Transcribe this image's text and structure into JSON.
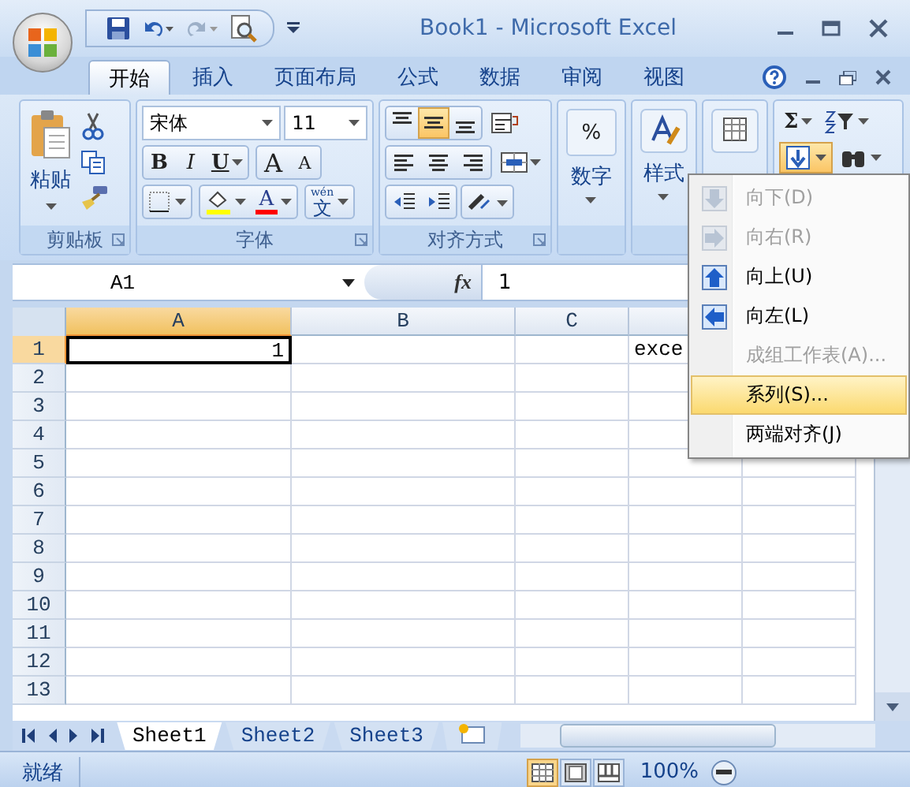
{
  "window": {
    "title": "Book1  -  Microsoft Excel"
  },
  "tabs": [
    {
      "label": "开始",
      "selected": true
    },
    {
      "label": "插入",
      "selected": false
    },
    {
      "label": "页面布局",
      "selected": false
    },
    {
      "label": "公式",
      "selected": false
    },
    {
      "label": "数据",
      "selected": false
    },
    {
      "label": "审阅",
      "selected": false
    },
    {
      "label": "视图",
      "selected": false
    }
  ],
  "ribbon": {
    "clipboard": {
      "label": "剪贴板",
      "paste": "粘贴"
    },
    "font": {
      "label": "字体",
      "font_name": "宋体",
      "font_size": "11",
      "bold": "B",
      "italic": "I",
      "underline": "U",
      "grow": "A",
      "shrink": "A",
      "phonetic_top": "wén",
      "phonetic_char": "文",
      "font_color_letter": "A"
    },
    "alignment": {
      "label": "对齐方式",
      "vertical": [
        {
          "selected": false
        },
        {
          "selected": true
        },
        {
          "selected": false
        }
      ]
    },
    "number": {
      "label": "数字",
      "symbol": "%"
    },
    "styles": {
      "label": "样式"
    },
    "editing": {
      "sum": "Σ",
      "fill_open": true
    }
  },
  "formula_bar": {
    "name_box": "A1",
    "fx": "fx",
    "value": "1"
  },
  "columns": [
    {
      "label": "A",
      "selected": true
    },
    {
      "label": "B",
      "selected": false
    },
    {
      "label": "C",
      "selected": false
    }
  ],
  "rows": [
    {
      "label": "1",
      "selected": true,
      "cells": {
        "A": "1",
        "D": "exce"
      }
    },
    {
      "label": "2",
      "selected": false
    },
    {
      "label": "3",
      "selected": false
    },
    {
      "label": "4",
      "selected": false
    },
    {
      "label": "5",
      "selected": false
    },
    {
      "label": "6",
      "selected": false
    },
    {
      "label": "7",
      "selected": false
    },
    {
      "label": "8",
      "selected": false
    },
    {
      "label": "9",
      "selected": false
    },
    {
      "label": "10",
      "selected": false
    },
    {
      "label": "11",
      "selected": false
    },
    {
      "label": "12",
      "selected": false
    },
    {
      "label": "13",
      "selected": false
    }
  ],
  "sheet_tabs": [
    {
      "label": "Sheet1",
      "selected": true
    },
    {
      "label": "Sheet2",
      "selected": false
    },
    {
      "label": "Sheet3",
      "selected": false
    }
  ],
  "status_bar": {
    "status": "就绪",
    "zoom": "100%",
    "views": [
      {
        "selected": true
      },
      {
        "selected": false
      },
      {
        "selected": false
      }
    ]
  },
  "fill_menu": {
    "items": [
      {
        "label": "向下(D)",
        "disabled": true,
        "selected": false
      },
      {
        "label": "向右(R)",
        "disabled": true,
        "selected": false
      },
      {
        "label": "向上(U)",
        "disabled": false,
        "selected": false
      },
      {
        "label": "向左(L)",
        "disabled": false,
        "selected": false
      },
      {
        "label": "成组工作表(A)...",
        "disabled": true,
        "selected": false
      },
      {
        "label": "系列(S)...",
        "disabled": false,
        "selected": true
      },
      {
        "label": "两端对齐(J)",
        "disabled": false,
        "selected": false
      }
    ]
  }
}
